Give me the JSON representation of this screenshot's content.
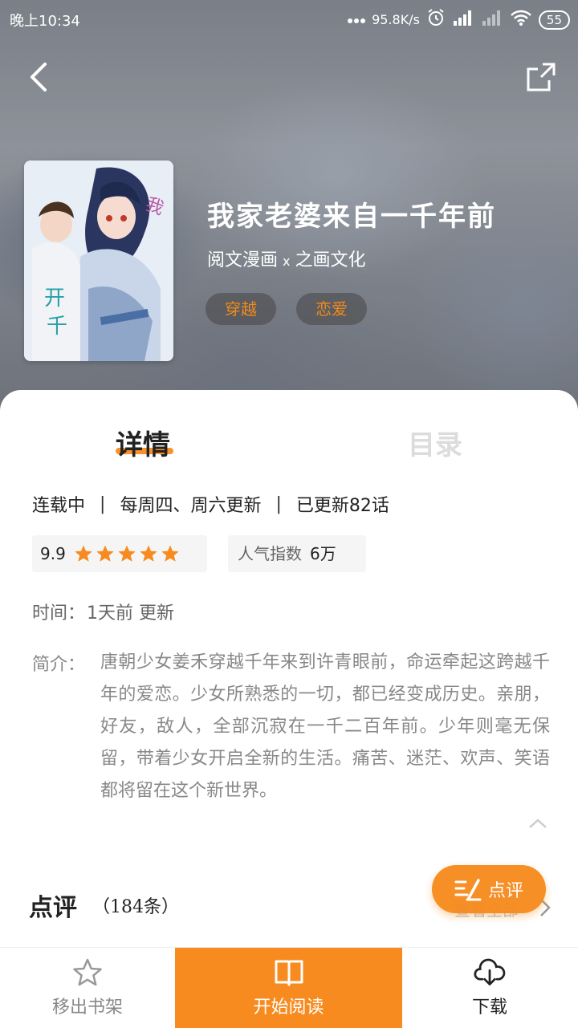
{
  "status_bar": {
    "time": "晚上10:34",
    "network_speed": "95.8K/s",
    "battery": "55",
    "icons": [
      "dots-icon",
      "alarm-icon",
      "signal-hd-icon",
      "signal-icon",
      "wifi-icon",
      "battery-icon"
    ]
  },
  "header": {
    "back_icon": "back-arrow-icon",
    "share_icon": "share-icon"
  },
  "comic": {
    "title": "我家老婆来自一千年前",
    "author1": "阅文漫画",
    "separator": "x",
    "author2": "之画文化",
    "tags": [
      "穿越",
      "恋爱"
    ]
  },
  "tabs": {
    "detail": "详情",
    "catalog": "目录"
  },
  "serial": {
    "status": "连载中",
    "schedule": "每周四、周六更新",
    "updated": "已更新82话"
  },
  "rating": {
    "score": "9.9",
    "stars": 5
  },
  "popularity": {
    "label": "人气指数",
    "value": "6万"
  },
  "time": {
    "label": "时间：",
    "value": "1天前 更新"
  },
  "intro": {
    "label": "简介：",
    "text": "唐朝少女姜禾穿越千年来到许青眼前，命运牵起这跨越千年的爱恋。少女所熟悉的一切，都已经变成历史。亲朋，好友，敌人，全部沉寂在一千二百年前。少年则毫无保留，带着少女开启全新的生活。痛苦、迷茫、欢声、笑语都将留在这个新世界。"
  },
  "reviews": {
    "title": "点评",
    "count": "（184条）",
    "view_all": "查看全部",
    "fab_label": "点评"
  },
  "bottom_bar": {
    "remove": "移出书架",
    "read": "开始阅读",
    "download": "下载"
  },
  "colors": {
    "accent": "#f78b1f",
    "tag_text": "#f28a1c"
  }
}
